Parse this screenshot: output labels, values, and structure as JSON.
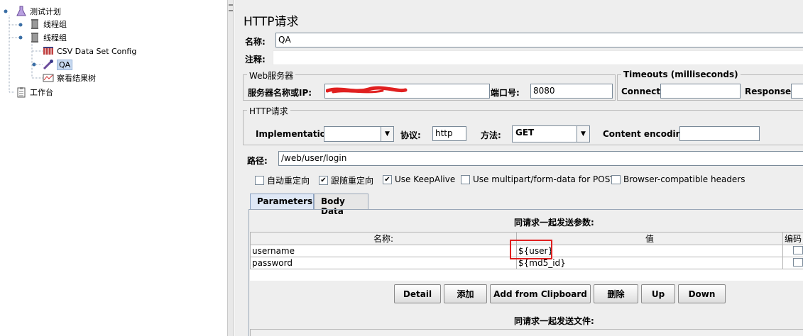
{
  "tree": {
    "root": "测试计划",
    "thread_group_1": "线程组",
    "thread_group_2": "线程组",
    "csv_config": "CSV Data Set Config",
    "sampler": "QA",
    "listener": "察看结果树",
    "workbench": "工作台"
  },
  "panel": {
    "title": "HTTP请求",
    "name_label": "名称:",
    "name_value": "QA",
    "comment_label": "注释:",
    "comment_value": ""
  },
  "web_server": {
    "group_title": "Web服务器",
    "server_label": "服务器名称或IP:",
    "server_value": "",
    "port_label": "端口号:",
    "port_value": "8080"
  },
  "timeouts": {
    "group_title": "Timeouts (milliseconds)",
    "connect_label": "Connect:",
    "connect_value": "",
    "response_label": "Response:",
    "response_value": ""
  },
  "http_request": {
    "group_title": "HTTP请求",
    "implementation_label": "Implementation:",
    "implementation_value": "",
    "protocol_label": "协议:",
    "protocol_value": "http",
    "method_label": "方法:",
    "method_value": "GET",
    "encoding_label": "Content encoding:",
    "encoding_value": "",
    "path_label": "路径:",
    "path_value": "/web/user/login"
  },
  "options": [
    {
      "label": "自动重定向",
      "checked": false
    },
    {
      "label": "跟随重定向",
      "checked": true
    },
    {
      "label": "Use KeepAlive",
      "checked": true
    },
    {
      "label": "Use multipart/form-data for POST",
      "checked": false
    },
    {
      "label": "Browser-compatible headers",
      "checked": false
    }
  ],
  "tabs": {
    "parameters": "Parameters",
    "body_data": "Body Data"
  },
  "params": {
    "caption": "同请求一起发送参数:",
    "col_name": "名称:",
    "col_value": "值",
    "col_encode": "编码",
    "rows": [
      {
        "name": "username",
        "value": "${user}"
      },
      {
        "name": "password",
        "value": "${md5_id}"
      }
    ]
  },
  "buttons": {
    "detail": "Detail",
    "add": "添加",
    "add_clipboard": "Add from Clipboard",
    "delete": "删除",
    "up": "Up",
    "down": "Down"
  },
  "files": {
    "caption": "同请求一起发送文件:"
  },
  "colors": {
    "highlight": "#e02020",
    "selection": "#c7d9f0"
  }
}
